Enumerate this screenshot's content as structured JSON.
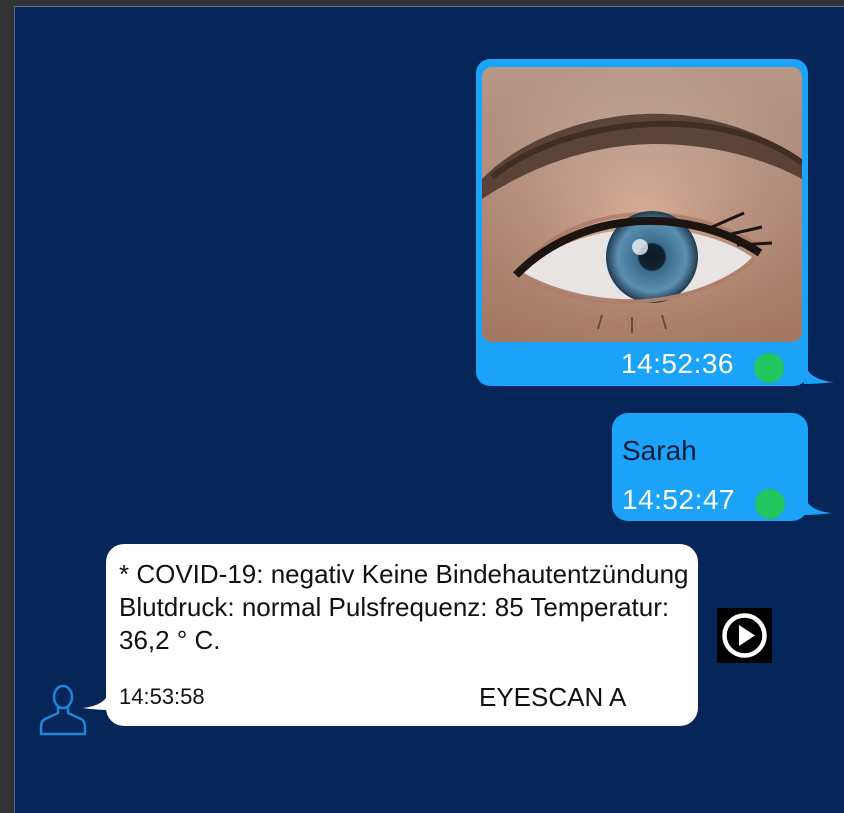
{
  "messages": {
    "image_message": {
      "time": "14:52:36",
      "status_color": "#22c55e"
    },
    "text_message": {
      "text": "Sarah",
      "time": "14:52:47",
      "status_color": "#22c55e"
    },
    "result_message": {
      "body": "* COVID-19: negativ Keine Bindehautentzündung Blutdruck: normal Pulsfrequenz: 85 Temperatur: 36,2 ° C.",
      "time": "14:53:58",
      "sender": "EYESCAN A"
    }
  },
  "icons": {
    "avatar": "user-avatar-icon",
    "play": "play-icon"
  },
  "colors": {
    "background": "#062558",
    "outgoing_bubble": "#1aa3f8",
    "incoming_bubble": "#ffffff",
    "read_indicator": "#22c55e"
  }
}
